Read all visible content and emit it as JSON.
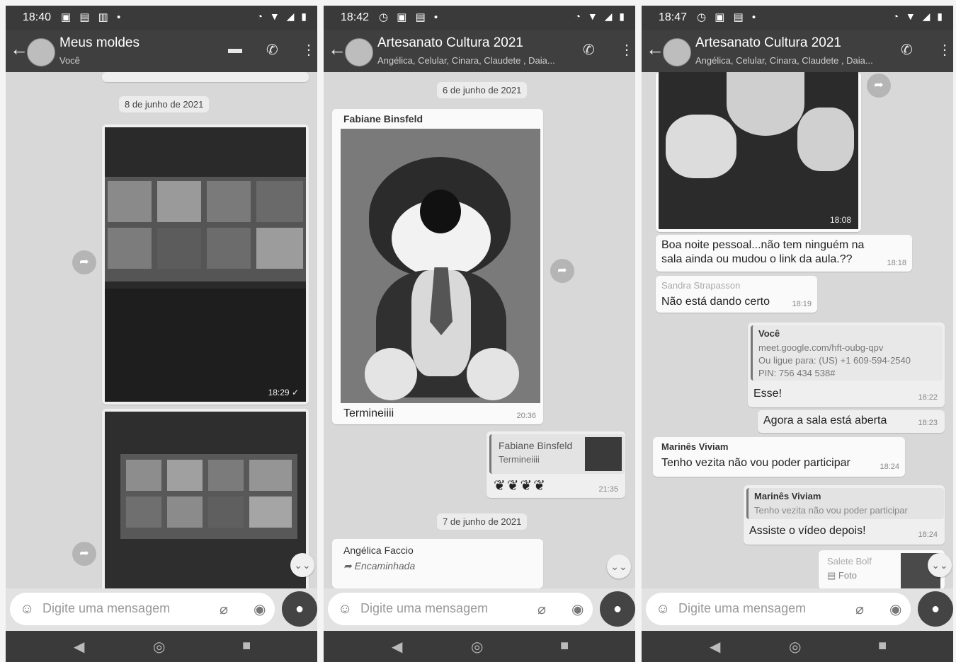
{
  "screens": [
    {
      "status_time": "18:40",
      "title": "Meus moldes",
      "subtitle": "Você",
      "date_chip": "8 de junho de 2021",
      "photo1_time": "18:29 ✓",
      "placeholder": "Digite uma mensagem"
    },
    {
      "status_time": "18:42",
      "title": "Artesanato Cultura 2021",
      "subtitle": "Angélica, Celular, Cinara, Claudete , Daia...",
      "date_chip_1": "6 de junho de 2021",
      "msg1_sender": "Fabiane Binsfeld",
      "msg1_caption": "Termineiiii",
      "msg1_time": "20:36",
      "reply_quote_sender": "Fabiane Binsfeld",
      "reply_quote_text": "Termineiiii",
      "reply_time": "21:35",
      "date_chip_2": "7 de junho de 2021",
      "msg3_sender": "Angélica Faccio",
      "msg3_forwarded": "Encaminhada",
      "placeholder": "Digite uma mensagem"
    },
    {
      "status_time": "18:47",
      "title": "Artesanato Cultura 2021",
      "subtitle": "Angélica, Celular, Cinara, Claudete , Daia...",
      "photo_time": "18:08",
      "msg_a_line1": "Boa noite pessoal...não tem ninguém  na",
      "msg_a_line2": "sala ainda ou mudou o link da aula.??",
      "msg_a_time": "18:18",
      "msg_b_sender": "Sandra Strapasson",
      "msg_b_text": "Não está dando certo",
      "msg_b_time": "18:19",
      "msg_c_sender": "Você",
      "msg_c_link1": "meet.google.com/hft-oubg-qpv",
      "msg_c_link2": "Ou ligue para: (US) +1 609-594-2540",
      "msg_c_link3": "PIN: 756 434 538#",
      "msg_c_text": "Esse!",
      "msg_c_time": "18:22",
      "msg_d_text": "Agora a sala está aberta",
      "msg_d_time": "18:23",
      "msg_e_sender": "Marinês Viviam",
      "msg_e_text": "Tenho vezita não vou poder participar",
      "msg_e_time": "18:24",
      "msg_f_quote_sender": "Marinês Viviam",
      "msg_f_quote_text": "Tenho vezita não vou poder participar",
      "msg_f_text": "Assiste o vídeo depois!",
      "msg_f_time": "18:24",
      "msg_g_sender": "Salete Bolf",
      "msg_g_text": "Foto",
      "placeholder": "Digite uma mensagem"
    }
  ]
}
